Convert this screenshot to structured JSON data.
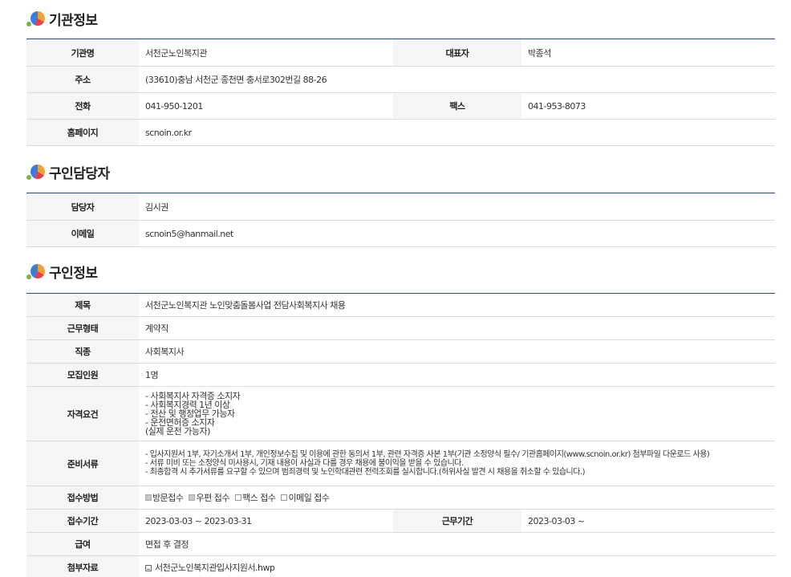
{
  "sections": {
    "agency": {
      "title": "기관정보"
    },
    "contact": {
      "title": "구인담당자"
    },
    "job": {
      "title": "구인정보"
    }
  },
  "agency": {
    "name_label": "기관명",
    "name": "서천군노인복지관",
    "ceo_label": "대표자",
    "ceo": "박종석",
    "address_label": "주소",
    "address": "(33610)충남 서천군 종천면 충서로302번길 88-26",
    "phone_label": "전화",
    "phone": "041-950-1201",
    "fax_label": "팩스",
    "fax": "041-953-8073",
    "homepage_label": "홈페이지",
    "homepage": "scnoin.or.kr"
  },
  "contact": {
    "manager_label": "담당자",
    "manager": "김시권",
    "email_label": "이메일",
    "email": "scnoin5@hanmail.net"
  },
  "job": {
    "subject_label": "제목",
    "subject": "서천군노인복지관 노인맞춤돌봄사업 전담사회복지사 채용",
    "employment_type_label": "근무형태",
    "employment_type": "계약직",
    "occupation_label": "직종",
    "occupation": "사회복지사",
    "headcount_label": "모집인원",
    "headcount": "1명",
    "qualification_label": "자격요건",
    "qualifications": [
      "- 사회복지사 자격증 소지자",
      "- 사회복지경력 1년 이상",
      "- 전산 및 행정업무 가능자",
      "- 운전면허증 소지자",
      " (실제 운전 가능자)"
    ],
    "documents_label": "준비서류",
    "documents": [
      "- 입사지원서 1부, 자기소개서 1부, 개인정보수집 및 이용에 관한 동의서 1부, 관련 자격증 사본 1부(기관 소정양식 필수/ 기관홈페이지(www.scnoin.or.kr) 첨부파일 다운로드 사용)",
      "- 서류 미비 또는 소정양식 미사용시, 기재 내용이 사실과 다를 경우 채용에 불이익을 받을 수 있습니다.",
      "- 최종합격 시 추가서류를 요구할 수 있으며 범죄경력 및 노인학대관련 전력조회를 실시합니다.(허위사실 발견 시 채용을 취소할 수 있습니다.)"
    ],
    "method_label": "접수방법",
    "methods": [
      {
        "label": "방문접수",
        "checked": true
      },
      {
        "label": "우편 접수",
        "checked": true
      },
      {
        "label": "팩스 접수",
        "checked": false
      },
      {
        "label": "이메일 접수",
        "checked": false
      }
    ],
    "period_label": "접수기간",
    "period": "2023-03-03 ~ 2023-03-31",
    "work_period_label": "근무기간",
    "work_period": "2023-03-03 ~",
    "salary_label": "급여",
    "salary": "면접 후 결정",
    "attachment_label": "첨부자료",
    "attachment": "서천군노인복지관입사지원서.hwp",
    "attachment_icon": "file-icon"
  }
}
